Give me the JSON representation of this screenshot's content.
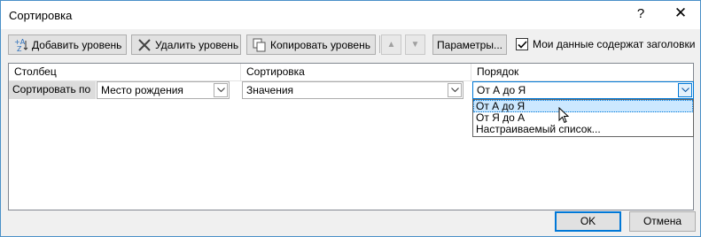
{
  "dialog": {
    "title": "Сортировка",
    "help_glyph": "?",
    "close_glyph": "✕"
  },
  "toolbar": {
    "add_level": "Добавить уровень",
    "delete_level": "Удалить уровень",
    "copy_level": "Копировать уровень",
    "move_up_glyph": "▲",
    "move_down_glyph": "▼",
    "options": "Параметры...",
    "headers_checkbox_label": "Мои данные содержат заголовки",
    "headers_checked": true
  },
  "grid": {
    "columns": [
      "Столбец",
      "Сортировка",
      "Порядок"
    ],
    "row": {
      "label": "Сортировать по",
      "column_value": "Место рождения",
      "sort_on_value": "Значения",
      "order_value": "От А до Я"
    }
  },
  "order_dropdown": {
    "options": [
      "От А до Я",
      "От Я до А",
      "Настраиваемый список..."
    ],
    "highlighted_index": 0
  },
  "footer": {
    "ok": "OK",
    "cancel": "Отмена"
  },
  "colors": {
    "accent": "#0078d7",
    "highlight": "#cce8ff",
    "dialog_bg": "#f0f0f0"
  }
}
